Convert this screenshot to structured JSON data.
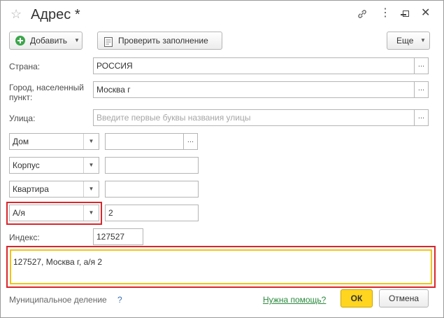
{
  "window": {
    "title": "Адрес *",
    "star_icon": "star-icon",
    "link_icon": "link-icon",
    "more_icon": "more-vertical-icon",
    "minimize_icon": "minimize-icon",
    "maximize_icon": "maximize-icon",
    "close_icon": "close-icon"
  },
  "toolbar": {
    "add_label": "Добавить",
    "check_label": "Проверить заполнение",
    "more_label": "Еще",
    "add_icon_color": "#3aa64a"
  },
  "form": {
    "country_label": "Страна:",
    "country_value": "РОССИЯ",
    "city_label": "Город, населенный пункт:",
    "city_value": "Москва г",
    "street_label": "Улица:",
    "street_placeholder": "Введите первые буквы названия улицы",
    "dots": "...",
    "house_type": "Дом",
    "house_value": "",
    "building_type": "Корпус",
    "building_value": "",
    "apartment_type": "Квартира",
    "apartment_value": "",
    "pobox_type": "А/я",
    "pobox_value": "2",
    "index_label": "Индекс:",
    "index_value": "127527",
    "address_text": "127527, Москва г, а/я 2"
  },
  "footer": {
    "municipal_label": "Муниципальное деление",
    "help_mark": "?",
    "help_link": "Нужна помощь?",
    "ok_label": "ОК",
    "cancel_label": "Отмена"
  },
  "colors": {
    "highlight_red": "#d9262c",
    "focus_yellow": "#f2c318",
    "ok_button": "#ffd51f",
    "link_green": "#2b8a3e"
  }
}
